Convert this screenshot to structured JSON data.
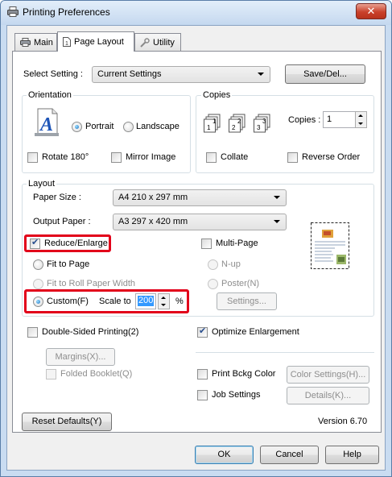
{
  "window": {
    "title": "Printing Preferences",
    "close_label": "✕"
  },
  "tabs": [
    {
      "label": "Main"
    },
    {
      "label": "Page Layout"
    },
    {
      "label": "Utility"
    }
  ],
  "select_setting": {
    "label": "Select Setting :",
    "value": "Current Settings",
    "save_button": "Save/Del..."
  },
  "orientation": {
    "group_label": "Orientation",
    "portrait": "Portrait",
    "landscape": "Landscape",
    "selected": "portrait",
    "rotate": "Rotate 180°",
    "mirror": "Mirror Image"
  },
  "copies": {
    "group_label": "Copies",
    "copies_label": "Copies :",
    "copies_value": "1",
    "collate": "Collate",
    "reverse": "Reverse Order"
  },
  "layout": {
    "group_label": "Layout",
    "paper_size_label": "Paper Size :",
    "paper_size_value": "A4 210 x 297 mm",
    "output_paper_label": "Output Paper :",
    "output_paper_value": "A3 297 x 420 mm",
    "reduce_enlarge": "Reduce/Enlarge",
    "fit_to_page": "Fit to Page",
    "fit_to_roll": "Fit to Roll Paper Width",
    "custom": "Custom(F)",
    "scale_to": "Scale to",
    "scale_value": "200",
    "percent": "%",
    "multi_page": "Multi-Page",
    "n_up": "N-up",
    "poster": "Poster(N)",
    "settings_button": "Settings..."
  },
  "bottom": {
    "double_sided": "Double-Sided Printing(2)",
    "margins_button": "Margins(X)...",
    "folded_booklet": "Folded Booklet(Q)",
    "optimize_enlargement": "Optimize Enlargement",
    "print_bckg_color": "Print Bckg Color",
    "color_settings_button": "Color Settings(H)...",
    "job_settings": "Job Settings",
    "details_button": "Details(K)..."
  },
  "footer": {
    "reset_button": "Reset Defaults(Y)",
    "version": "Version 6.70",
    "ok": "OK",
    "cancel": "Cancel",
    "help": "Help"
  },
  "colors": {
    "highlight_red": "#e2001a",
    "selection_blue": "#3399ff"
  }
}
